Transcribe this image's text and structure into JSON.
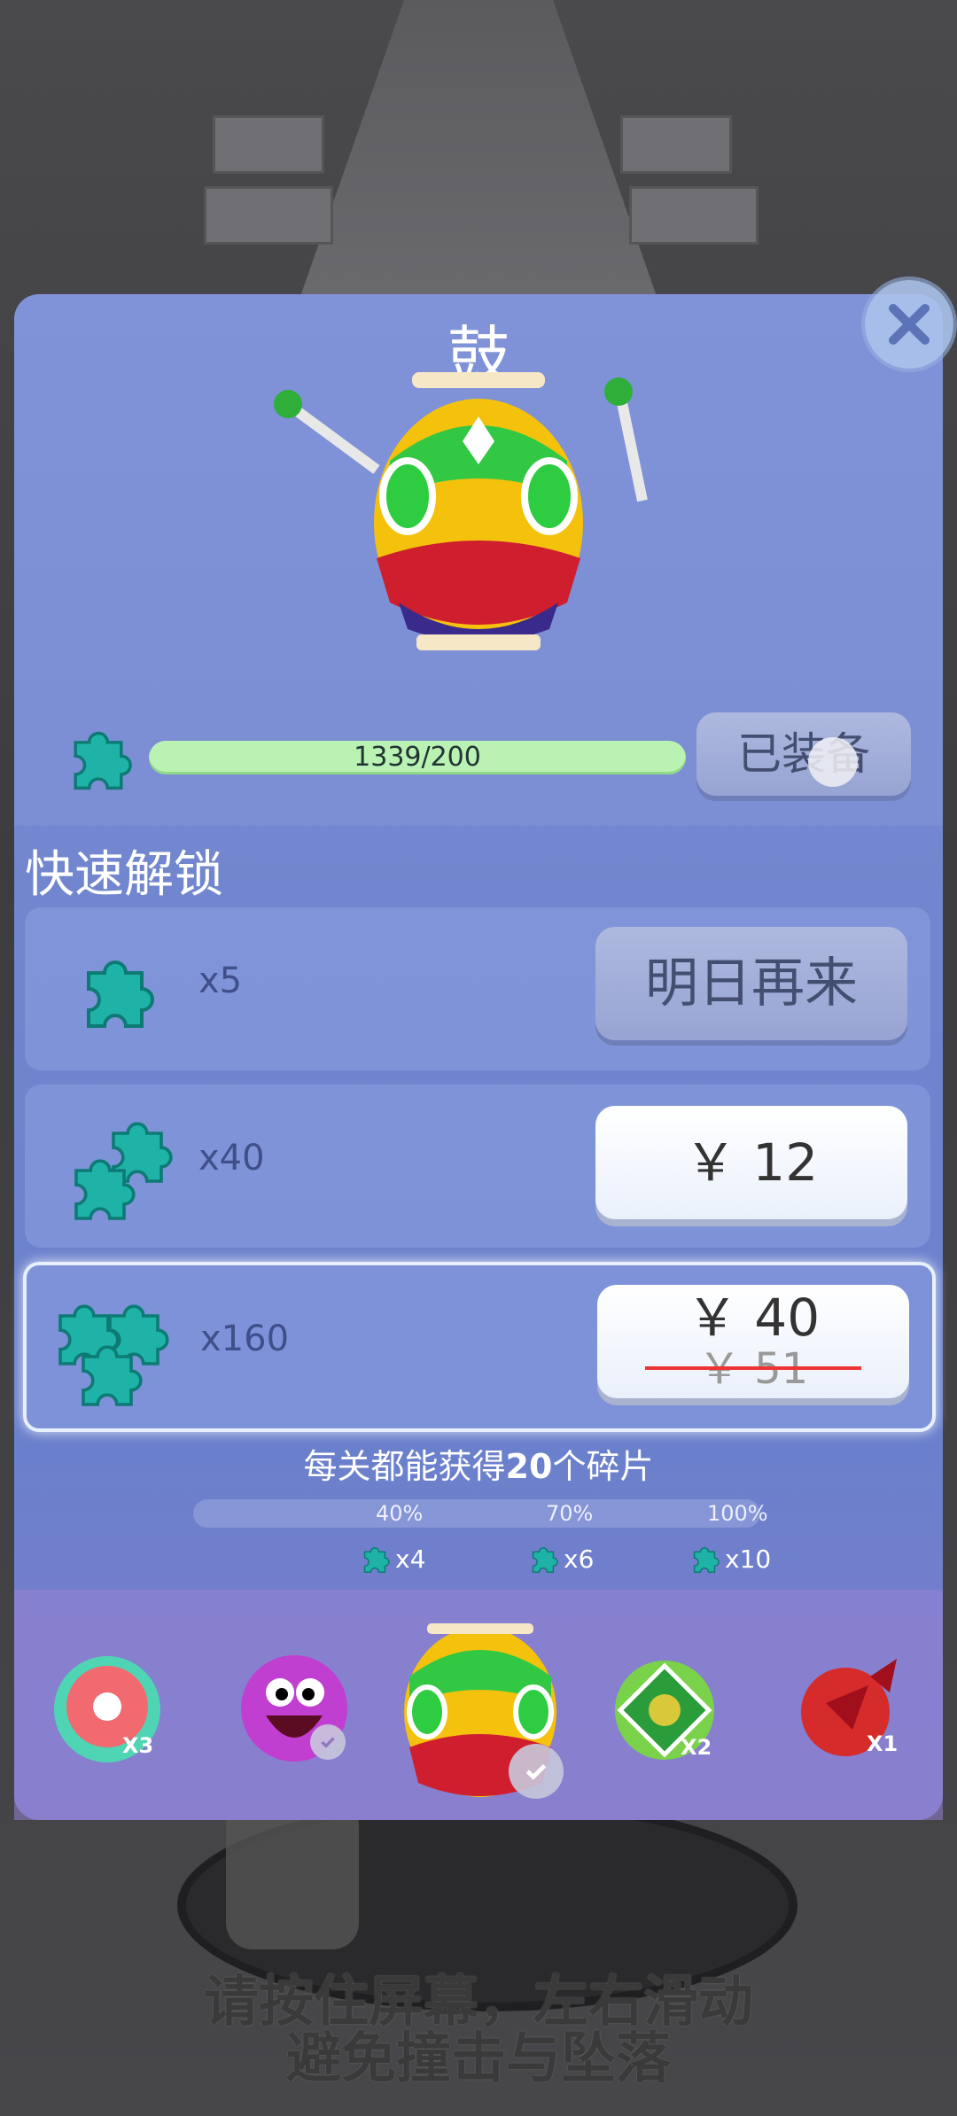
{
  "app": {
    "title": "鼓"
  },
  "progress": {
    "text": "1339/200",
    "value": 1339,
    "max": 200
  },
  "equip_button": {
    "label": "已装备"
  },
  "quick_unlock": {
    "title": "快速解锁",
    "rows": [
      {
        "qty": "x5",
        "button": "明日再来"
      },
      {
        "qty": "x40",
        "price": "￥ 12"
      },
      {
        "qty": "x160",
        "price": "￥ 40",
        "original_price": "￥ 51"
      }
    ]
  },
  "info": {
    "prefix": "每关都能获得",
    "number": "20",
    "suffix": "个碎片"
  },
  "milestones": [
    {
      "percent": "40%",
      "reward": "x4"
    },
    {
      "percent": "70%",
      "reward": "x6"
    },
    {
      "percent": "100%",
      "reward": "x10"
    }
  ],
  "tray": {
    "items": [
      {
        "name": "flower-ball",
        "badge": "X3"
      },
      {
        "name": "purple-face-ball",
        "badge": ""
      },
      {
        "name": "drum-ball",
        "badge": ""
      },
      {
        "name": "green-gem-ball",
        "badge": "X2"
      },
      {
        "name": "red-bow-ball",
        "badge": "X1"
      }
    ]
  },
  "hint": {
    "line1": "请按住屏幕，左右滑动",
    "line2": "避免撞击与坠落"
  },
  "colors": {
    "panel": "#7186ce",
    "progress": "#b9f2b2",
    "puzzle": "#1fb3a8",
    "close": "#aac3eb"
  }
}
